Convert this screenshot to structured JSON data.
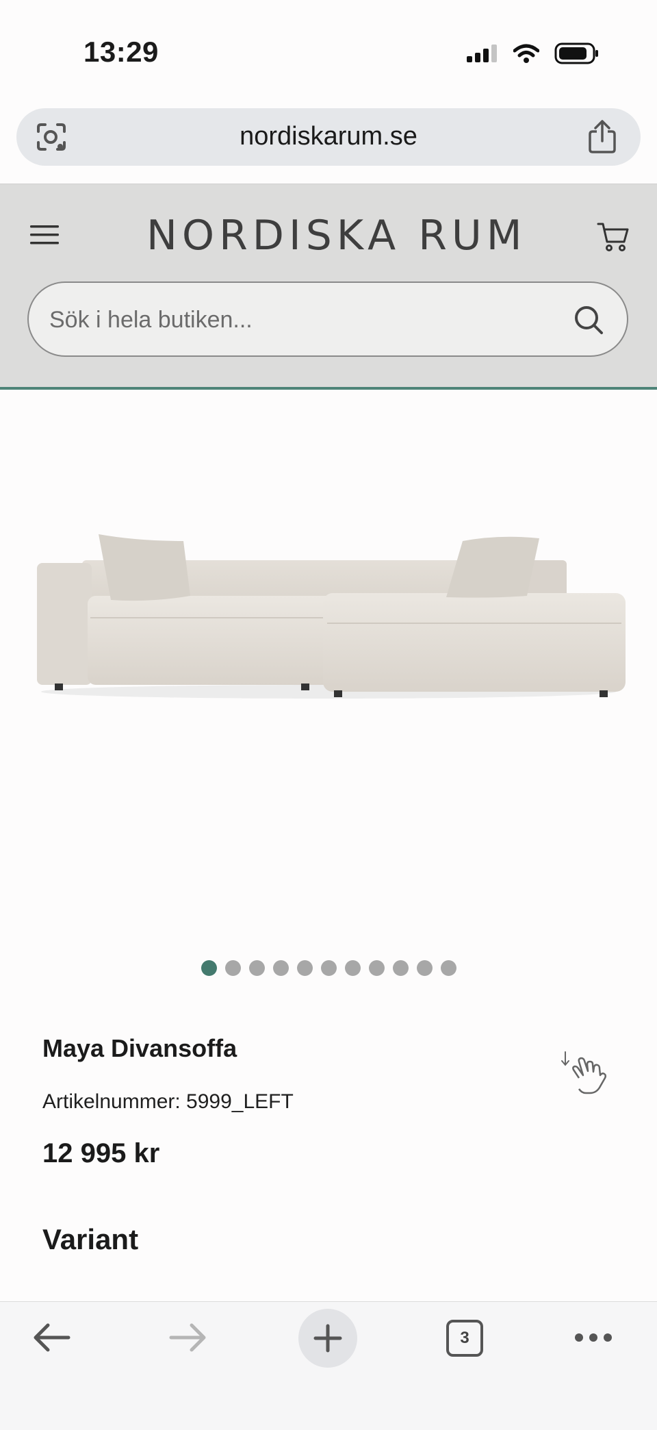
{
  "status_bar": {
    "time": "13:29"
  },
  "browser": {
    "url": "nordiskarum.se",
    "open_tabs": "3"
  },
  "site": {
    "logo_text": "NORDISKA RUM",
    "search_placeholder": "Sök i hela butiken..."
  },
  "carousel": {
    "total_dots": 11,
    "active_index": 0
  },
  "product": {
    "name": "Maya Divansoffa",
    "article_number": "Artikelnummer: 5999_LEFT",
    "price": "12 995 kr",
    "variant_heading": "Variant"
  },
  "icons": {
    "lens": "google-lens-icon",
    "share": "share-icon",
    "menu": "hamburger-menu-icon",
    "cart": "shopping-cart-icon",
    "search": "search-icon",
    "scroll_hint": "hand-scroll-icon"
  },
  "colors": {
    "accent": "#447a6e",
    "header_bg": "#dcdcdb",
    "sofa": "#e2ddd6"
  }
}
